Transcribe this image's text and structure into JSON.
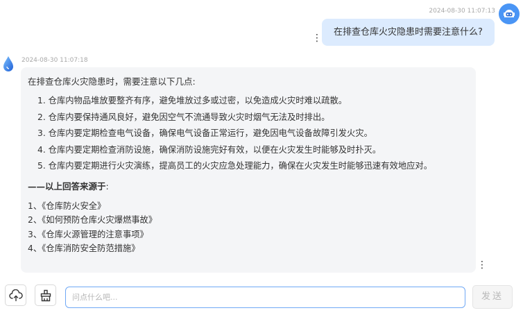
{
  "user_message": {
    "timestamp": "2024-08-30 11:07:13",
    "text": "在排查仓库火灾隐患时需要注意什么?"
  },
  "bot_message": {
    "timestamp": "2024-08-30 11:07:18",
    "intro": "在排查仓库火灾隐患时，需要注意以下几点:",
    "points": [
      "1. 仓库内物品堆放要整齐有序，避免堆放过多或过密，以免造成火灾时难以疏散。",
      "2. 仓库内要保持通风良好，避免因空气不流通导致火灾时烟气无法及时排出。",
      "3. 仓库内要定期检查电气设备，确保电气设备正常运行，避免因电气设备故障引发火灾。",
      "4. 仓库内要定期检查消防设施，确保消防设施完好有效，以便在火灾发生时能够及时扑灭。",
      "5. 仓库内要定期进行火灾演练，提高员工的火灾应急处理能力，确保在火灾发生时能够迅速有效地应对。"
    ],
    "source_title": "——以上回答来源于",
    "source_colon": ":",
    "sources": [
      "1、《仓库防火安全》",
      "2、《如何预防仓库火灾爆燃事故》",
      "3、《仓库火源管理的注意事项》",
      "4、《仓库消防安全防范措施》"
    ]
  },
  "input": {
    "placeholder": "问点什么吧..."
  },
  "send_button": {
    "label": "发送"
  },
  "colors": {
    "accent": "#4a95f5",
    "user_bubble": "#dcebfe",
    "bot_bubble": "#f4f5f7"
  },
  "icons": {
    "upload": "cloud-upload-icon",
    "clear": "broom-icon",
    "more": "kebab-menu-icon"
  }
}
